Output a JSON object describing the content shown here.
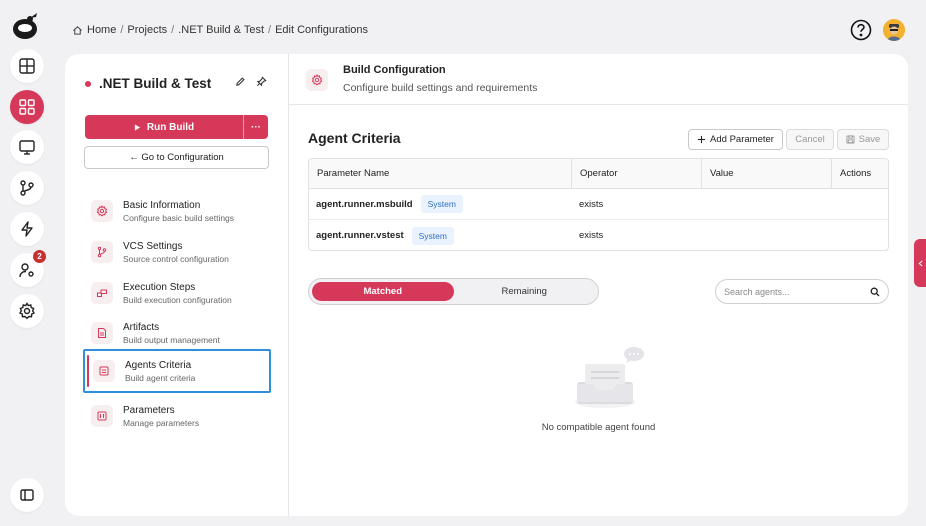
{
  "breadcrumb": {
    "items": [
      "Home",
      "Projects",
      ".NET Build & Test",
      "Edit Configurations"
    ],
    "separator": "/"
  },
  "rail": {
    "items": [
      {
        "name": "dashboard-icon",
        "active": false
      },
      {
        "name": "projects-icon",
        "active": true
      },
      {
        "name": "monitor-icon",
        "active": false
      },
      {
        "name": "vcs-branch-icon",
        "active": false
      },
      {
        "name": "lightning-icon",
        "active": false
      },
      {
        "name": "user-gear-icon",
        "active": false,
        "badge": "2"
      },
      {
        "name": "gear-icon",
        "active": false
      }
    ]
  },
  "project": {
    "title": ".NET Build & Test",
    "run_label": "Run Build",
    "more_label": "···",
    "goto_label": "← Go to Configuration"
  },
  "nav": [
    {
      "title": "Basic Information",
      "sub": "Configure basic build settings",
      "icon": "gear-icon"
    },
    {
      "title": "VCS Settings",
      "sub": "Source control configuration",
      "icon": "branch-icon"
    },
    {
      "title": "Execution Steps",
      "sub": "Build execution configuration",
      "icon": "steps-icon"
    },
    {
      "title": "Artifacts",
      "sub": "Build output management",
      "icon": "file-icon"
    },
    {
      "title": "Agents Criteria",
      "sub": "Build agent criteria",
      "icon": "agent-icon",
      "active": true
    },
    {
      "title": "Parameters",
      "sub": "Manage parameters",
      "icon": "params-icon"
    }
  ],
  "header": {
    "title": "Build Configuration",
    "subtitle": "Configure build settings and requirements"
  },
  "section": {
    "title": "Agent Criteria",
    "add_label": "Add Parameter",
    "cancel_label": "Cancel",
    "save_label": "Save"
  },
  "table": {
    "columns": [
      "Parameter Name",
      "Operator",
      "Value",
      "Actions"
    ],
    "rows": [
      {
        "name": "agent.runner.msbuild",
        "tag": "System",
        "operator": "exists",
        "value": ""
      },
      {
        "name": "agent.runner.vstest",
        "tag": "System",
        "operator": "exists",
        "value": ""
      }
    ]
  },
  "tabs": {
    "matched": "Matched",
    "remaining": "Remaining"
  },
  "search": {
    "placeholder": "Search agents..."
  },
  "empty": {
    "message": "No compatible agent found"
  },
  "colors": {
    "accent": "#d6385a",
    "focus": "#2f8fdc",
    "tag_bg": "#eaf2fd",
    "tag_text": "#2f6fc4"
  }
}
